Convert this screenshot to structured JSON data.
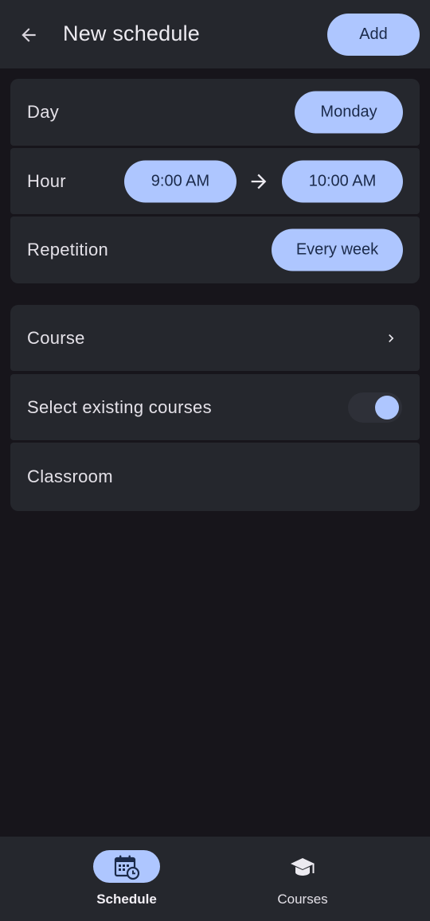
{
  "appbar": {
    "title": "New schedule",
    "add_label": "Add"
  },
  "form": {
    "day": {
      "label": "Day",
      "value": "Monday"
    },
    "hour": {
      "label": "Hour",
      "start": "9:00 AM",
      "end": "10:00 AM"
    },
    "repetition": {
      "label": "Repetition",
      "value": "Every week"
    },
    "course": {
      "label": "Course"
    },
    "existing": {
      "label": "Select existing courses",
      "enabled": true
    },
    "classroom": {
      "label": "Classroom"
    }
  },
  "nav": {
    "items": [
      {
        "label": "Schedule",
        "icon": "calendar-clock-icon",
        "active": true
      },
      {
        "label": "Courses",
        "icon": "graduation-cap-icon",
        "active": false
      }
    ]
  },
  "colors": {
    "accent": "#aec6ff",
    "surface": "#25272d",
    "background": "#17151b"
  }
}
